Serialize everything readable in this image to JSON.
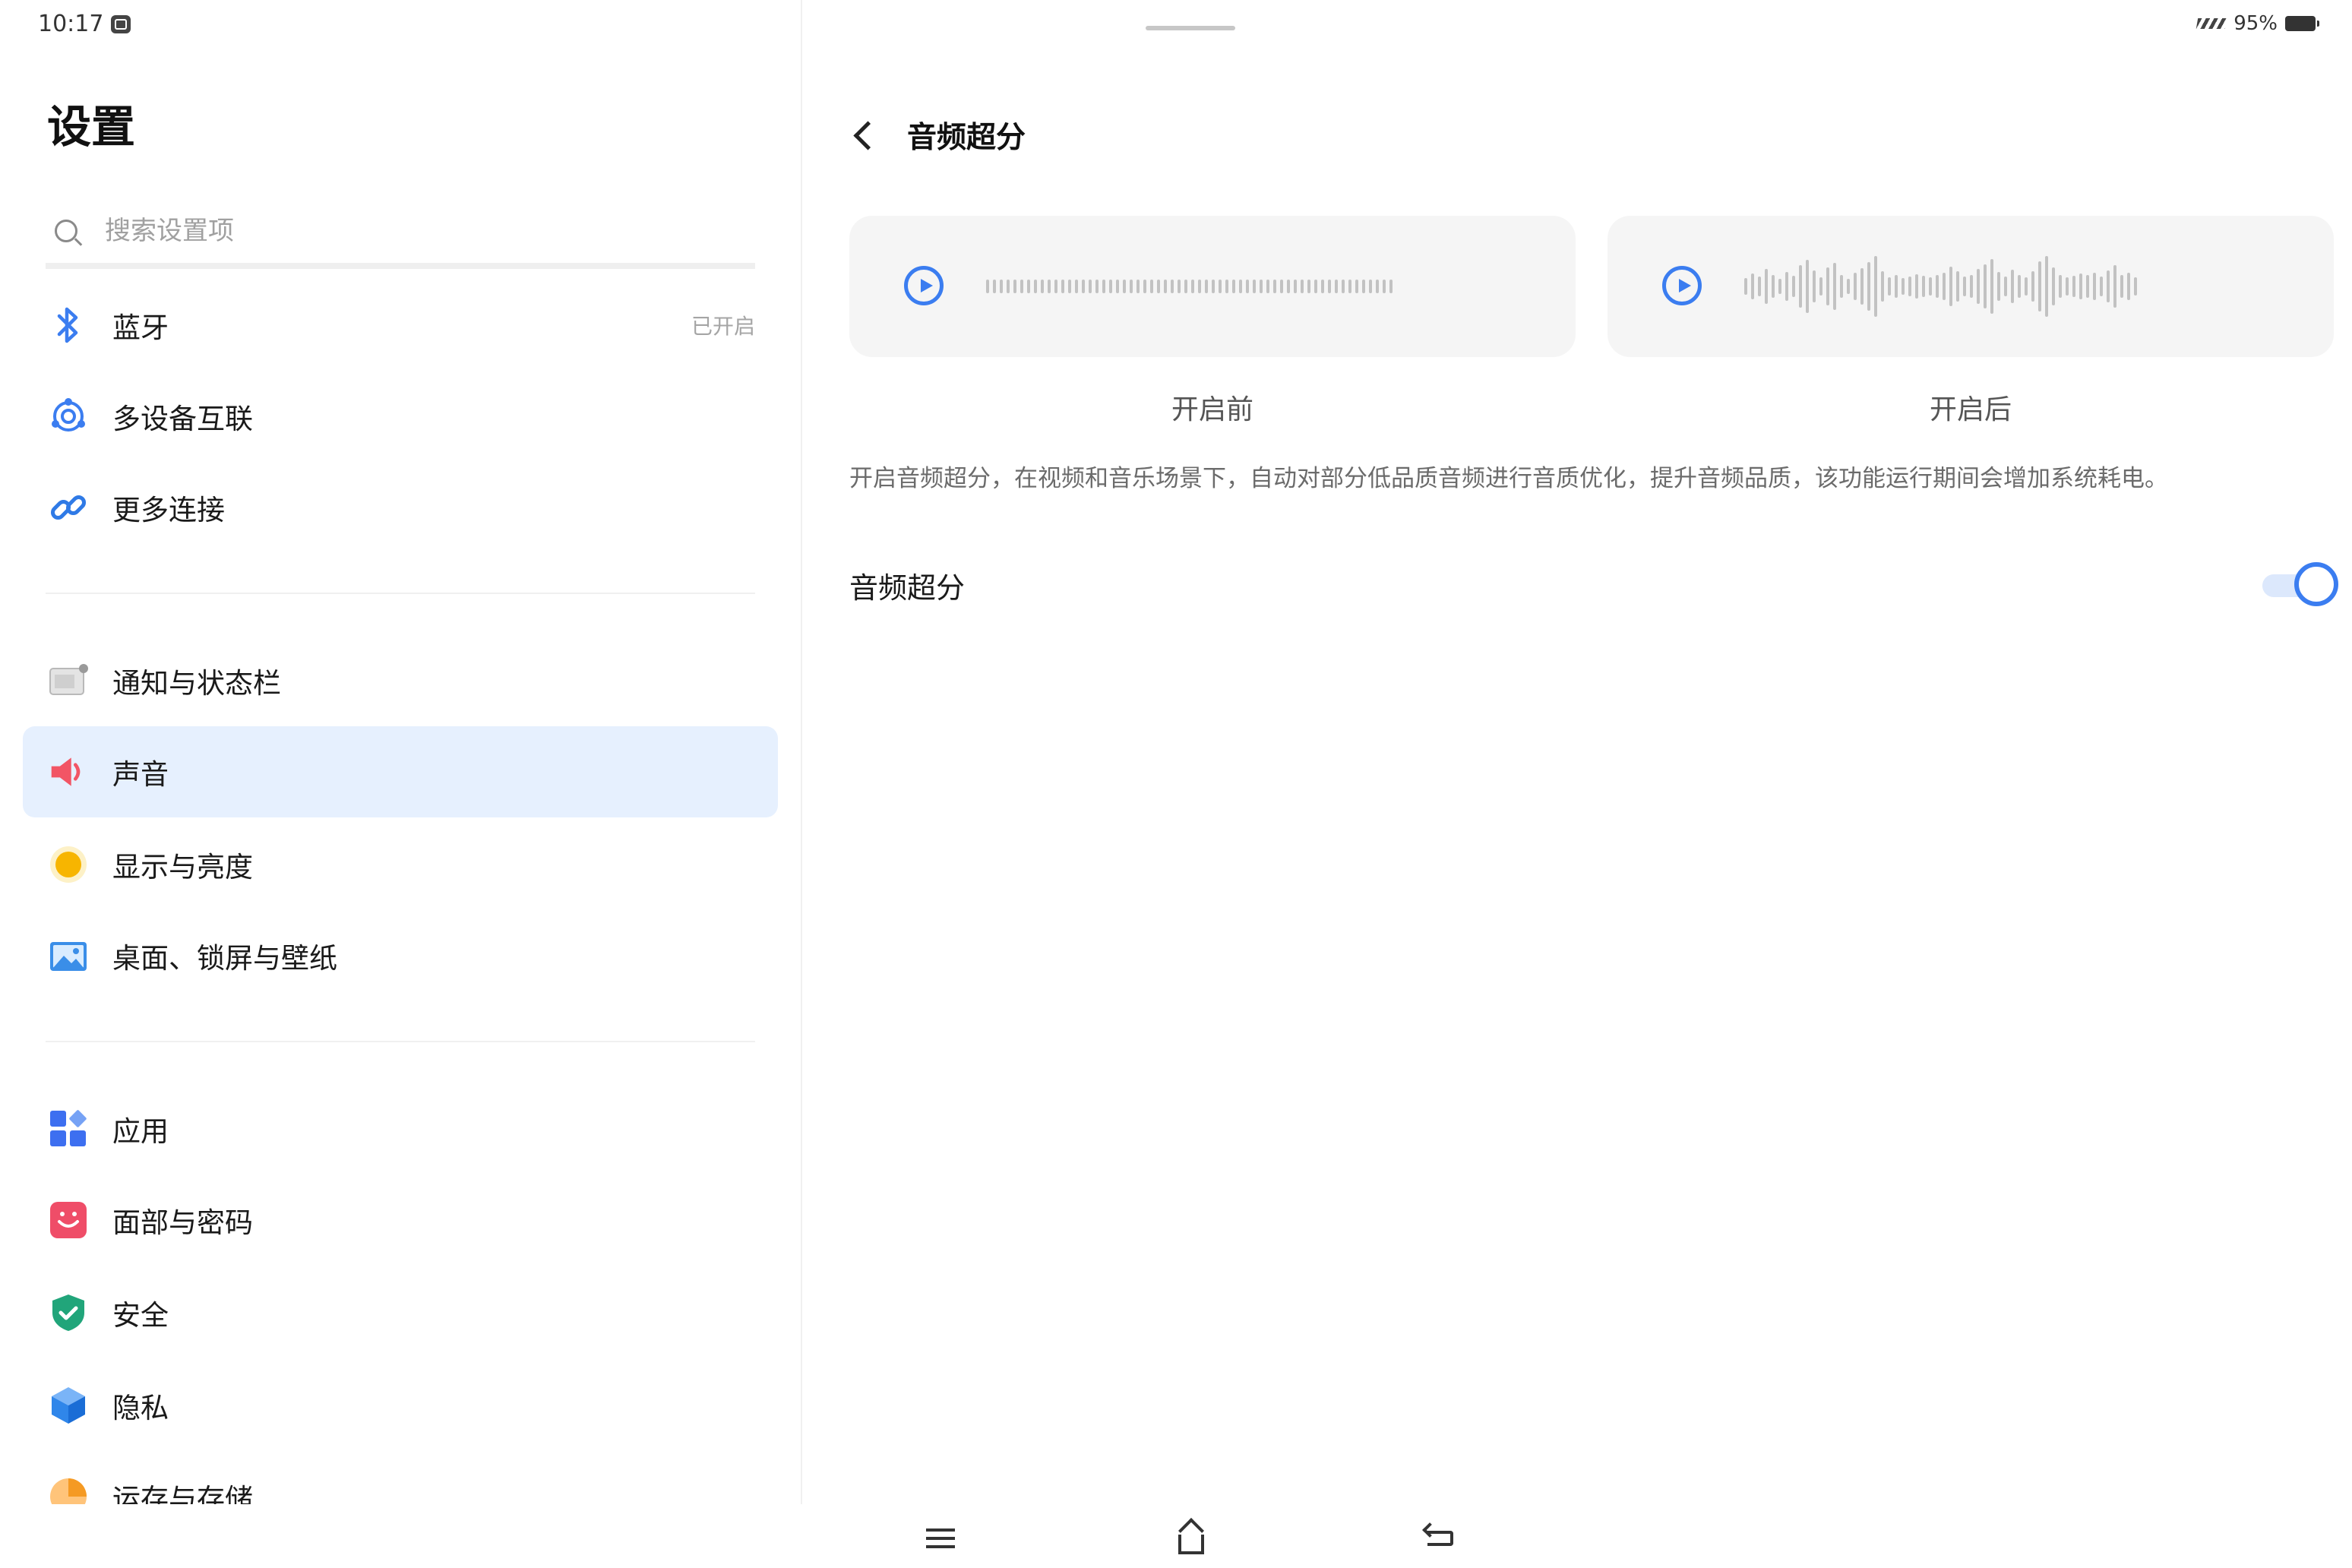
{
  "status_bar": {
    "time": "10:17",
    "battery": "95%"
  },
  "sidebar": {
    "title": "设置",
    "search_placeholder": "搜索设置项",
    "items": [
      {
        "label": "蓝牙",
        "status": "已开启",
        "icon": "bluetooth-icon"
      },
      {
        "label": "多设备互联",
        "icon": "multi-device-icon"
      },
      {
        "label": "更多连接",
        "icon": "link-icon"
      },
      {
        "label": "通知与状态栏",
        "icon": "notification-icon"
      },
      {
        "label": "声音",
        "icon": "sound-icon",
        "active": true
      },
      {
        "label": "显示与亮度",
        "icon": "brightness-icon"
      },
      {
        "label": "桌面、锁屏与壁纸",
        "icon": "wallpaper-icon"
      },
      {
        "label": "应用",
        "icon": "apps-icon"
      },
      {
        "label": "面部与密码",
        "icon": "face-password-icon"
      },
      {
        "label": "安全",
        "icon": "security-shield-icon"
      },
      {
        "label": "隐私",
        "icon": "privacy-cube-icon"
      },
      {
        "label": "运存与存储",
        "icon": "storage-icon"
      }
    ]
  },
  "detail": {
    "title": "音频超分",
    "before_label": "开启前",
    "after_label": "开启后",
    "description": "开启音频超分，在视频和音乐场景下，自动对部分低品质音频进行音质优化，提升音频品质，该功能运行期间会增加系统耗电。",
    "toggle_label": "音频超分",
    "toggle_on": true
  },
  "colors": {
    "accent": "#3b7df0",
    "active_row": "#e6f0fe"
  }
}
